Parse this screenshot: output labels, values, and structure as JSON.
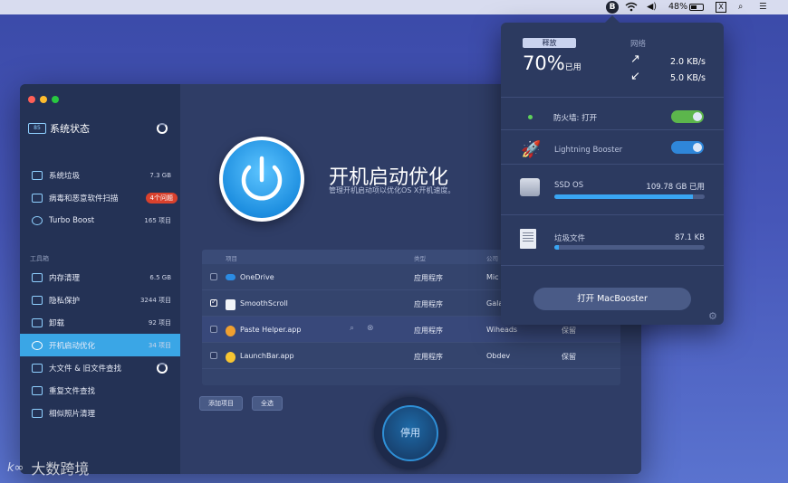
{
  "menubar": {
    "app_icon": "B",
    "battery": "48%",
    "icons": [
      "booster-icon",
      "wifi-icon",
      "volume-icon",
      "battery-icon",
      "x-icon",
      "search-icon",
      "list-icon"
    ]
  },
  "window": {
    "sidebar": {
      "status_label": "系统状态",
      "status_icon_text": "85",
      "items_top": [
        {
          "label": "系统垃圾",
          "value": "7.3 GB"
        },
        {
          "label": "病毒和恶意软件扫描",
          "value": "4个问题"
        },
        {
          "label": "Turbo Boost",
          "value": "165 项目"
        }
      ],
      "section_label": "工具箱",
      "items_tools": [
        {
          "label": "内存清理",
          "value": "6.5 GB"
        },
        {
          "label": "隐私保护",
          "value": "3244 项目"
        },
        {
          "label": "卸载",
          "value": "92 项目"
        },
        {
          "label": "开机启动优化",
          "value": "34 项目"
        },
        {
          "label": "大文件 & 旧文件查找",
          "value": ""
        },
        {
          "label": "重复文件查找",
          "value": ""
        },
        {
          "label": "相似照片清理",
          "value": ""
        }
      ]
    },
    "content": {
      "title": "开机启动优化",
      "subtitle": "管理开机启动项以优化OS X开机速度。",
      "table": {
        "headers": [
          "项目",
          "类型",
          "公司"
        ],
        "rows": [
          {
            "name": "OneDrive",
            "type": "应用程序",
            "company": "Mic",
            "status": ""
          },
          {
            "name": "SmoothScroll",
            "type": "应用程序",
            "company": "Gala",
            "status": ""
          },
          {
            "name": "Paste Helper.app",
            "type": "应用程序",
            "company": "Wiheads",
            "status": "保留"
          },
          {
            "name": "LaunchBar.app",
            "type": "应用程序",
            "company": "Obdev",
            "status": "保留"
          }
        ]
      },
      "add_button": "添加项目",
      "select_all_button": "全选",
      "stop_button": "停用"
    }
  },
  "popover": {
    "free_label": "释放",
    "free_pct": "70%",
    "free_suffix": "已用",
    "network_label": "网络",
    "upload": "2.0 KB/s",
    "download": "5.0 KB/s",
    "firewall": "防火墙: 打开",
    "booster": "Lightning Booster",
    "disk_name": "SSD OS",
    "disk_value": "109.78 GB 已用",
    "disk_fill": 0.92,
    "junk_label": "垃圾文件",
    "junk_value": "87.1 KB",
    "junk_fill": 0.03,
    "open_button": "打开 MacBooster"
  },
  "watermark": {
    "logo": "k∞",
    "text": "大数跨境"
  },
  "colors": {
    "accent": "#3aa6e6",
    "alert": "#d9412d",
    "toggle_green": "#5cb64c",
    "toggle_blue": "#2f86d9"
  }
}
